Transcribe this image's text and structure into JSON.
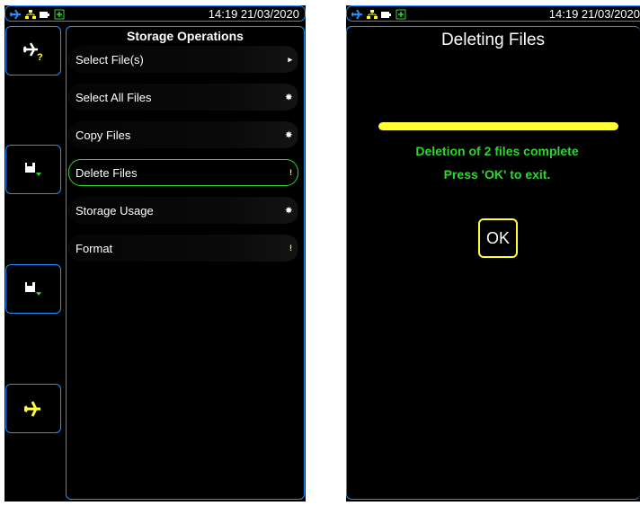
{
  "left_screen": {
    "status_bar": {
      "time": "14:19 21/03/2020",
      "icons": [
        "plane-icon",
        "network-icon",
        "battery-icon",
        "power-icon"
      ]
    },
    "side_buttons": [
      {
        "icon": "plane-help-icon"
      },
      {
        "icon": "save-down-icon"
      },
      {
        "icon": "save-down-icon"
      },
      {
        "icon": "plane-icon"
      }
    ],
    "menu": {
      "title": "Storage Operations",
      "items": [
        {
          "label": "Select File(s)",
          "indicator": "▸",
          "indicator_color": "#ffffff"
        },
        {
          "label": "Select All Files",
          "indicator": "✸",
          "indicator_color": "#ffffff"
        },
        {
          "label": "Copy Files",
          "indicator": "✸",
          "indicator_color": "#ffffff"
        },
        {
          "label": "Delete Files",
          "indicator": "!",
          "indicator_color": "#ffff33",
          "selected": true
        },
        {
          "label": "Storage Usage",
          "indicator": "✸",
          "indicator_color": "#ffffff"
        },
        {
          "label": "Format",
          "indicator": "!",
          "indicator_color": "#ffff33"
        }
      ]
    }
  },
  "right_screen": {
    "status_bar": {
      "time": "14:19 21/03/2020"
    },
    "title": "Deleting Files",
    "progress_fraction": 1.0,
    "message_line1": "Deletion of 2 files complete",
    "message_line2": "Press 'OK' to exit.",
    "ok_label": "OK"
  },
  "colors": {
    "accent_blue": "#1e90ff",
    "status_green": "#2fd52f",
    "warning_yellow": "#ffff33",
    "background": "#000000"
  }
}
